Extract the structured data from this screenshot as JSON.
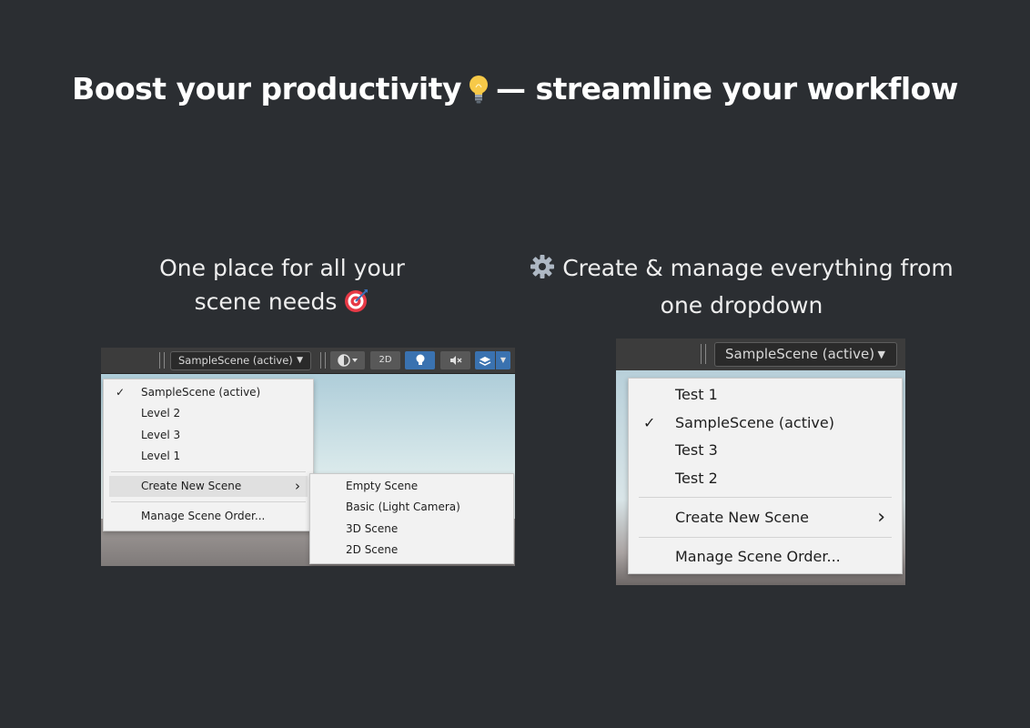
{
  "heading": {
    "part1": "Boost your productivity",
    "bulb_icon": "lightbulb-emoji-icon",
    "part2": "— streamline your workflow"
  },
  "captions": {
    "left": {
      "line1": "One place for all your",
      "line2": "scene needs",
      "icon": "target-emoji-icon"
    },
    "right": {
      "icon": "gear-emoji-icon",
      "line1": "Create & manage everything from",
      "line2": "one dropdown"
    }
  },
  "left_screenshot": {
    "toolbar": {
      "scene_dropdown": "SampleScene (active)",
      "btn_2d": "2D",
      "icons": [
        "shading-mode-icon",
        "lighting-icon",
        "audio-mute-icon",
        "effects-icon",
        "dropdown-arrow-icon"
      ]
    },
    "menu": {
      "items": [
        {
          "label": "SampleScene (active)",
          "checked": true
        },
        {
          "label": "Level 2",
          "checked": false
        },
        {
          "label": "Level 3",
          "checked": false
        },
        {
          "label": "Level 1",
          "checked": false
        }
      ],
      "create_new": "Create New Scene",
      "manage": "Manage Scene Order..."
    },
    "submenu": {
      "items": [
        "Empty Scene",
        "Basic (Light  Camera)",
        "3D Scene",
        "2D Scene"
      ]
    }
  },
  "right_screenshot": {
    "toolbar": {
      "scene_dropdown": "SampleScene (active)"
    },
    "menu": {
      "items": [
        {
          "label": "Test 1",
          "checked": false
        },
        {
          "label": "SampleScene (active)",
          "checked": true
        },
        {
          "label": "Test 3",
          "checked": false
        },
        {
          "label": "Test 2",
          "checked": false
        }
      ],
      "create_new": "Create New Scene",
      "manage": "Manage Scene Order..."
    }
  },
  "symbols": {
    "check": "✓",
    "chevron": "›"
  },
  "colors": {
    "page_bg": "#2b2e32",
    "unity_toolbar": "#3c3c3c",
    "active_button": "#3a72b0",
    "menu_bg": "#f2f2f2"
  }
}
